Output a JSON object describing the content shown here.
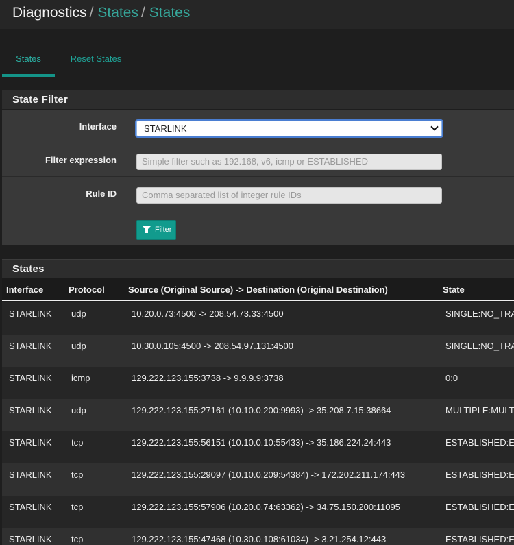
{
  "breadcrumb": {
    "root": "Diagnostics",
    "sep": "/",
    "items": [
      "States",
      "States"
    ]
  },
  "tabs": [
    {
      "label": "States",
      "active": true
    },
    {
      "label": "Reset States",
      "active": false
    }
  ],
  "filter_panel": {
    "title": "State Filter",
    "interface": {
      "label": "Interface",
      "value": "STARLINK"
    },
    "filter_expression": {
      "label": "Filter expression",
      "placeholder": "Simple filter such as 192.168, v6, icmp or ESTABLISHED"
    },
    "rule_id": {
      "label": "Rule ID",
      "placeholder": "Comma separated list of integer rule IDs"
    },
    "button_label": "Filter"
  },
  "states_panel": {
    "title": "States",
    "columns": [
      "Interface",
      "Protocol",
      "Source (Original Source) -> Destination (Original Destination)",
      "State"
    ],
    "rows": [
      {
        "interface": "STARLINK",
        "protocol": "udp",
        "flow": "10.20.0.73:4500 -> 208.54.73.33:4500",
        "state": "SINGLE:NO_TRA"
      },
      {
        "interface": "STARLINK",
        "protocol": "udp",
        "flow": "10.30.0.105:4500 -> 208.54.97.131:4500",
        "state": "SINGLE:NO_TRA"
      },
      {
        "interface": "STARLINK",
        "protocol": "icmp",
        "flow": "129.222.123.155:3738 -> 9.9.9.9:3738",
        "state": "0:0"
      },
      {
        "interface": "STARLINK",
        "protocol": "udp",
        "flow": "129.222.123.155:27161 (10.10.0.200:9993) -> 35.208.7.15:38664",
        "state": "MULTIPLE:MULT"
      },
      {
        "interface": "STARLINK",
        "protocol": "tcp",
        "flow": "129.222.123.155:56151 (10.10.0.10:55433) -> 35.186.224.24:443",
        "state": "ESTABLISHED:E"
      },
      {
        "interface": "STARLINK",
        "protocol": "tcp",
        "flow": "129.222.123.155:29097 (10.10.0.209:54384) -> 172.202.211.174:443",
        "state": "ESTABLISHED:E"
      },
      {
        "interface": "STARLINK",
        "protocol": "tcp",
        "flow": "129.222.123.155:57906 (10.20.0.74:63362) -> 34.75.150.200:11095",
        "state": "ESTABLISHED:E"
      },
      {
        "interface": "STARLINK",
        "protocol": "tcp",
        "flow": "129.222.123.155:47468 (10.30.0.108:61034) -> 3.21.254.12:443",
        "state": "ESTABLISHED:E"
      }
    ]
  },
  "colors": {
    "accent": "#119b8d",
    "link": "#36a69a",
    "background": "#1e1e1e"
  }
}
